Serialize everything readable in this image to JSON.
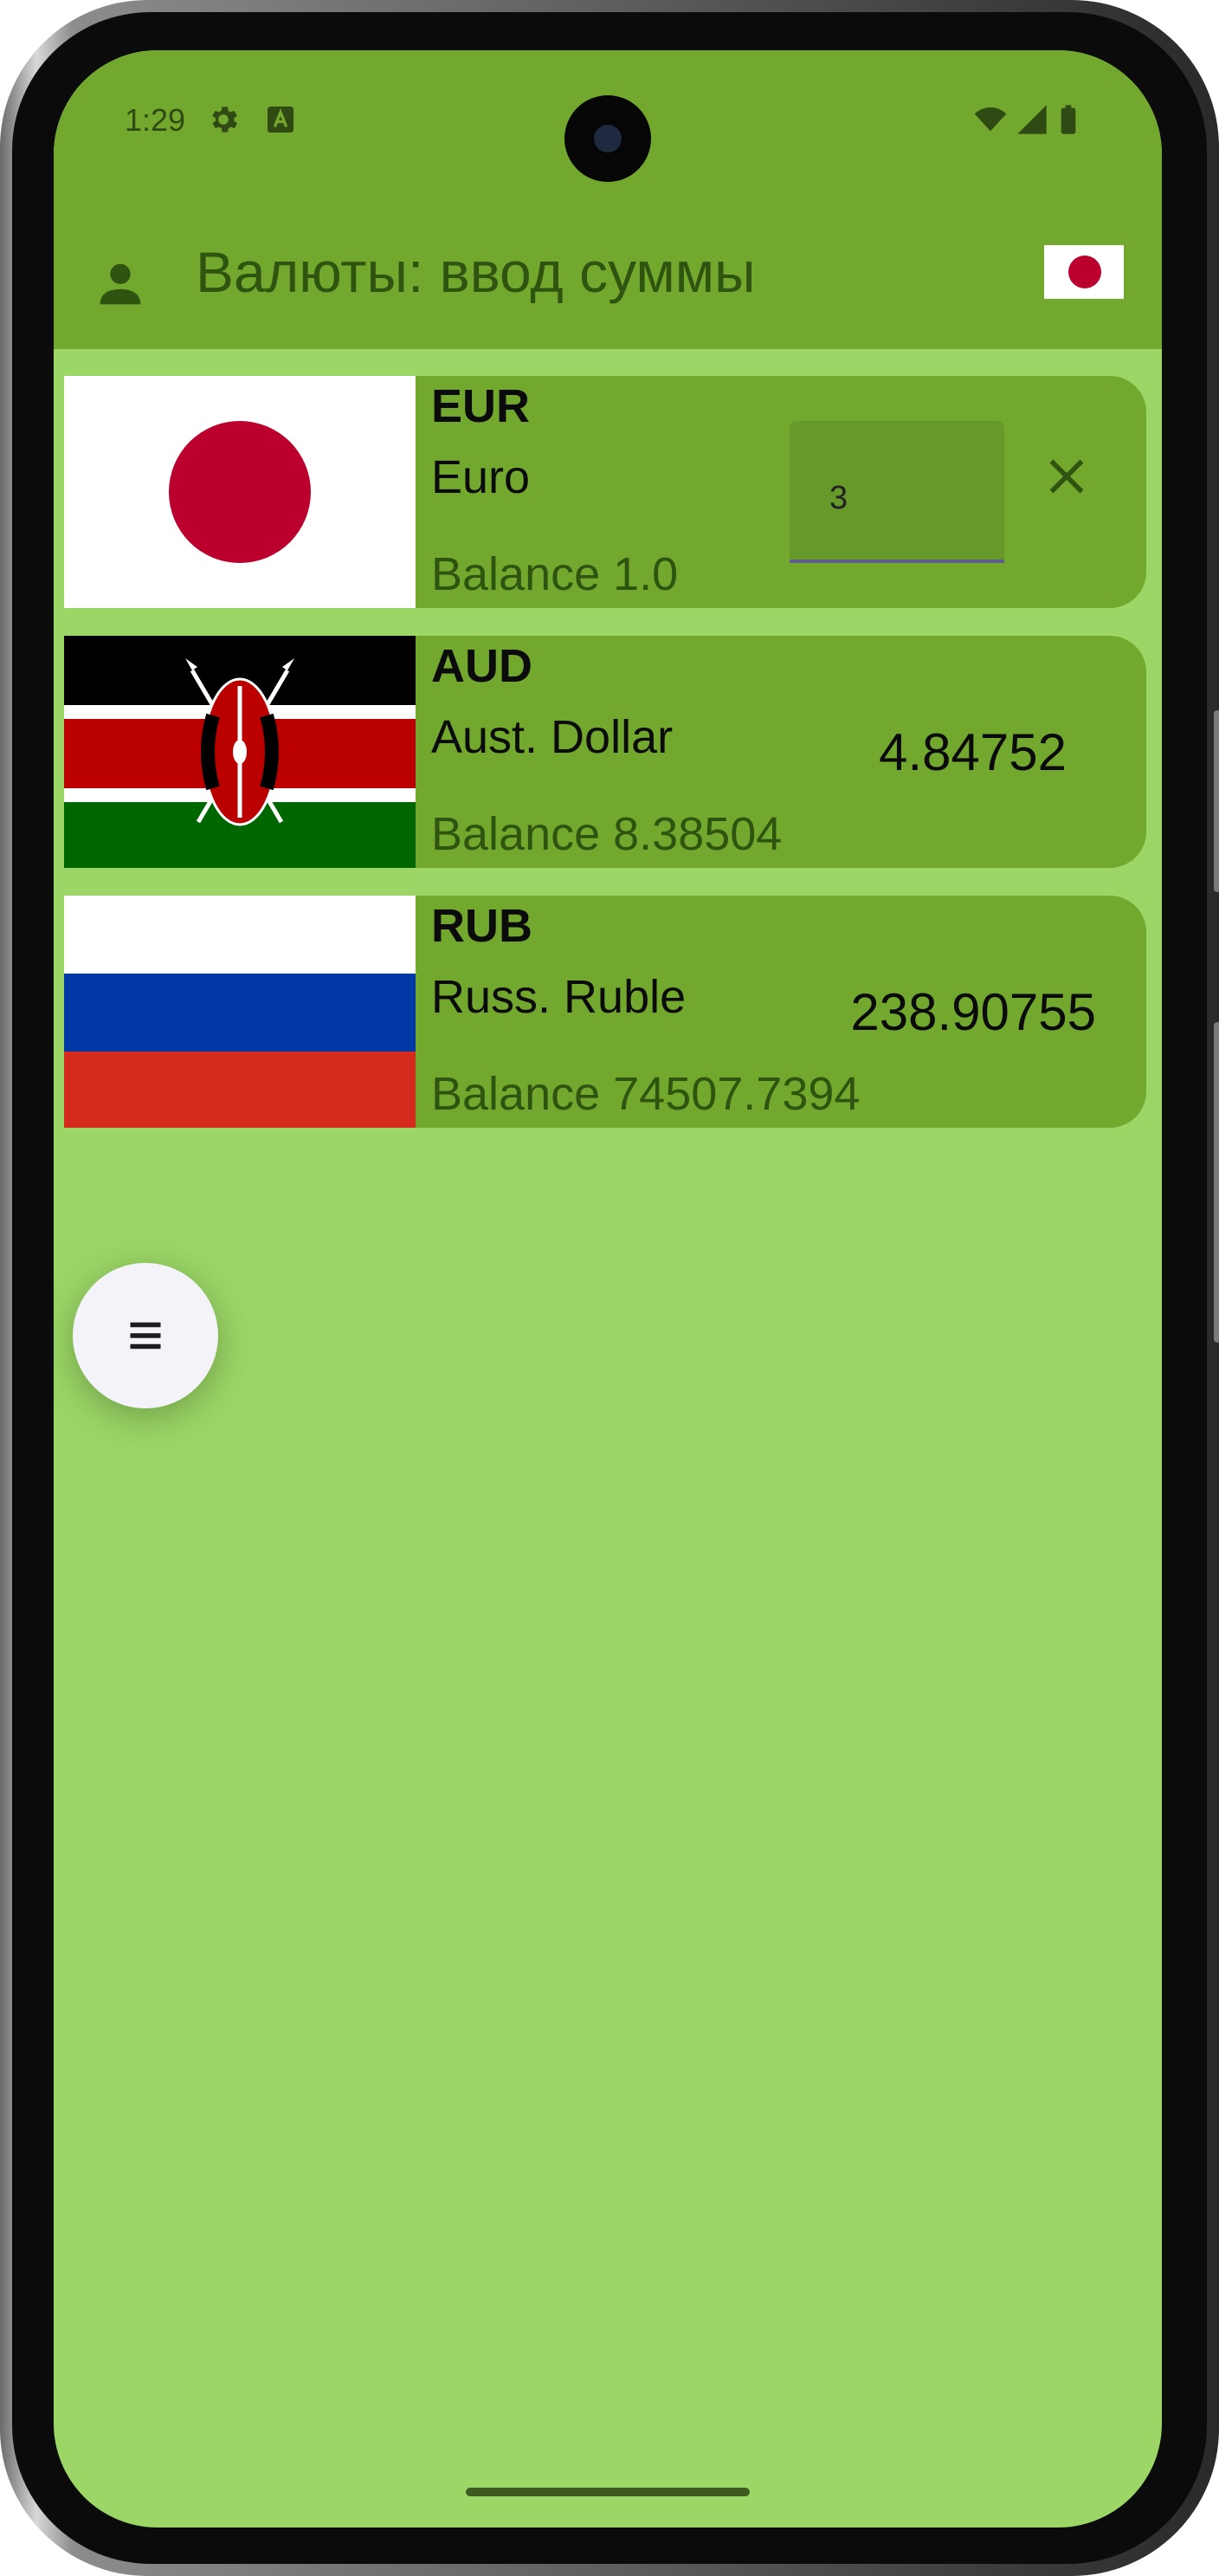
{
  "status_bar": {
    "time": "1:29"
  },
  "app_bar": {
    "title": "Валюты: ввод суммы"
  },
  "currencies": [
    {
      "code": "EUR",
      "name": "Euro",
      "balance": "Balance 1.0",
      "amount_input": "3",
      "flag": "japan-flag"
    },
    {
      "code": "AUD",
      "name": "Aust. Dollar",
      "balance": "Balance 8.38504",
      "value": "4.84752",
      "flag": "kenya-flag"
    },
    {
      "code": "RUB",
      "name": "Russ. Ruble",
      "balance": "Balance 74507.7394",
      "value": "238.90755",
      "flag": "russia-flag"
    }
  ],
  "colors": {
    "app_bar": "#73a82f",
    "background": "#9bd667",
    "card": "#73a82f",
    "balance_text": "#2f5410"
  }
}
